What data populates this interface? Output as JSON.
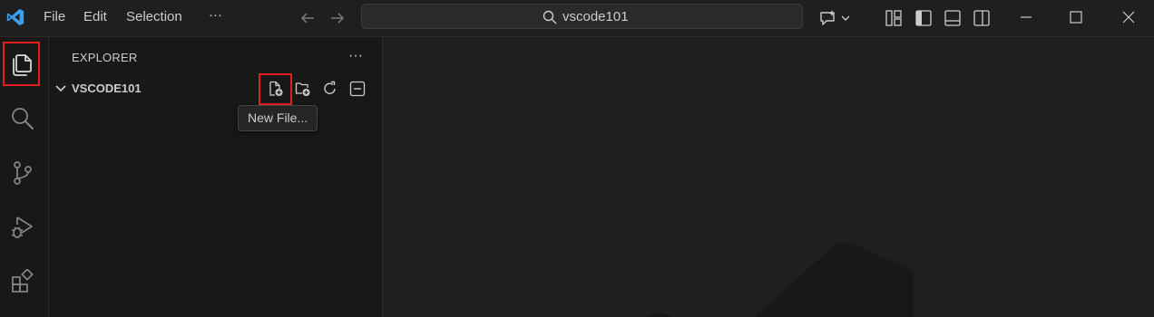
{
  "titlebar": {
    "menu": [
      "File",
      "Edit",
      "Selection"
    ],
    "more_label": "···",
    "search_text": "vscode101",
    "colors": {
      "logo": "#3aa0f0",
      "highlight": "#e02020"
    }
  },
  "activity_bar": {
    "items": [
      {
        "name": "explorer",
        "icon": "files-icon",
        "selected": true
      },
      {
        "name": "search",
        "icon": "search-icon"
      },
      {
        "name": "source-control",
        "icon": "source-control-icon"
      },
      {
        "name": "run-debug",
        "icon": "run-debug-icon"
      },
      {
        "name": "extensions",
        "icon": "extensions-icon"
      }
    ]
  },
  "sidebar": {
    "title": "EXPLORER",
    "more_label": "···",
    "folder_name": "VSCODE101",
    "actions": [
      "new-file-icon",
      "new-folder-icon",
      "refresh-icon",
      "collapse-all-icon"
    ],
    "tooltip": "New File..."
  }
}
